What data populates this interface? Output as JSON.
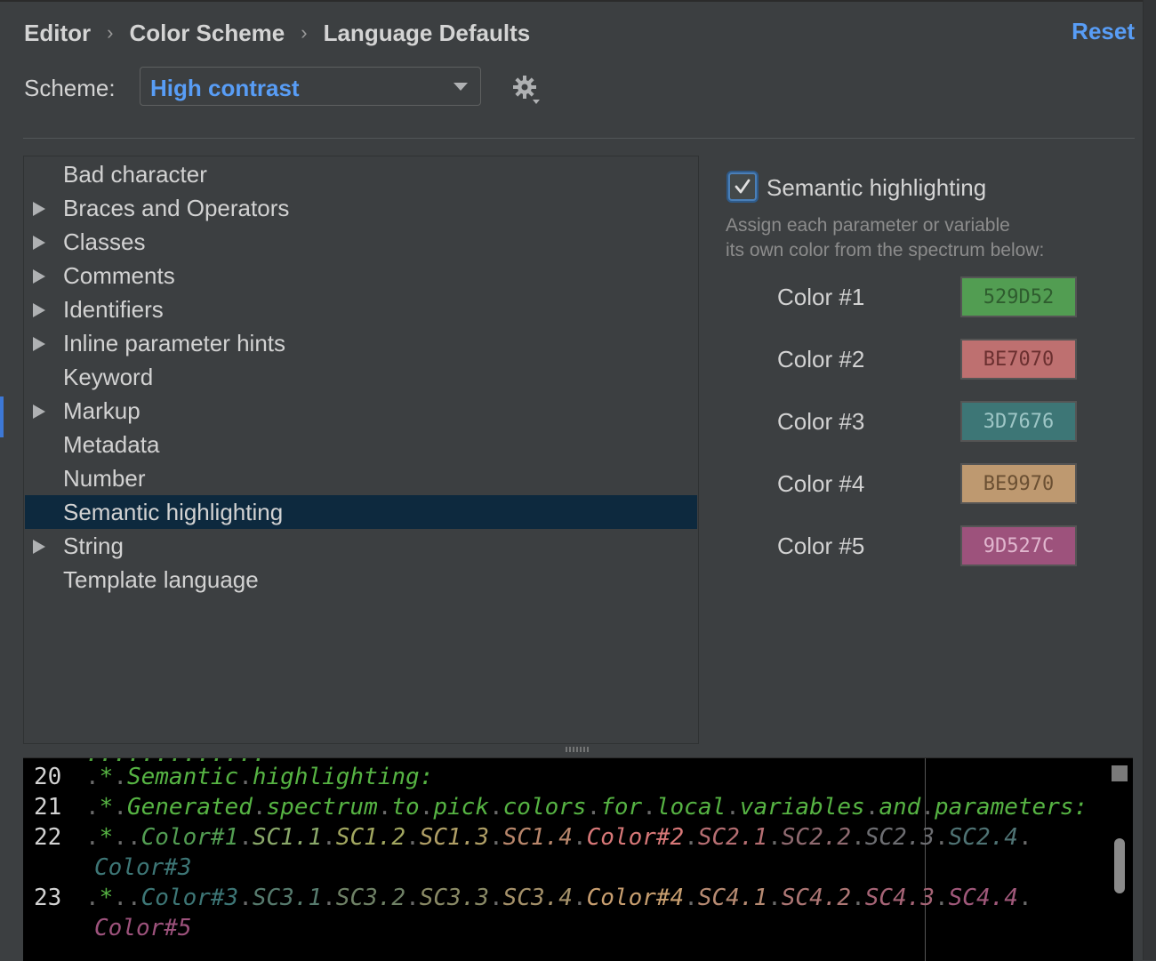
{
  "breadcrumb": [
    "Editor",
    "Color Scheme",
    "Language Defaults"
  ],
  "breadcrumb_sep": "›",
  "reset_label": "Reset",
  "scheme": {
    "label": "Scheme:",
    "value": "High contrast"
  },
  "tree_items": [
    {
      "label": "Bad character",
      "expandable": false
    },
    {
      "label": "Braces and Operators",
      "expandable": true
    },
    {
      "label": "Classes",
      "expandable": true
    },
    {
      "label": "Comments",
      "expandable": true
    },
    {
      "label": "Identifiers",
      "expandable": true
    },
    {
      "label": "Inline parameter hints",
      "expandable": true
    },
    {
      "label": "Keyword",
      "expandable": false
    },
    {
      "label": "Markup",
      "expandable": true
    },
    {
      "label": "Metadata",
      "expandable": false
    },
    {
      "label": "Number",
      "expandable": false
    },
    {
      "label": "Semantic highlighting",
      "expandable": false,
      "selected": true
    },
    {
      "label": "String",
      "expandable": true
    },
    {
      "label": "Template language",
      "expandable": false
    }
  ],
  "semantic": {
    "checkbox_label": "Semantic highlighting",
    "checked": true,
    "desc_line1": "Assign each parameter or variable",
    "desc_line2": "its own color from the spectrum below:",
    "colors": [
      {
        "label": "Color #1",
        "hex": "529D52",
        "bg": "#529D52",
        "fg": "#2f5d2f"
      },
      {
        "label": "Color #2",
        "hex": "BE7070",
        "bg": "#BE7070",
        "fg": "#6b3030"
      },
      {
        "label": "Color #3",
        "hex": "3D7676",
        "bg": "#3D7676",
        "fg": "#9ec6c6"
      },
      {
        "label": "Color #4",
        "hex": "BE9970",
        "bg": "#BE9970",
        "fg": "#6b5033"
      },
      {
        "label": "Color #5",
        "hex": "9D527C",
        "bg": "#9D527C",
        "fg": "#e0b6ce"
      }
    ]
  },
  "editor": {
    "line20": {
      "num": "20",
      "text": "Semantic highlighting:"
    },
    "line21": {
      "num": "21",
      "text": "Generated spectrum to pick colors for local variables and parameters:"
    },
    "line22": {
      "num": "22",
      "tokens": [
        {
          "t": "Color#1",
          "c": "#529D52"
        },
        {
          "t": "SC1.1",
          "c": "#8aa86a"
        },
        {
          "t": "SC1.2",
          "c": "#a2a760"
        },
        {
          "t": "SC1.3",
          "c": "#b09f66"
        },
        {
          "t": "SC1.4",
          "c": "#b8866b"
        },
        {
          "t": "Color#2",
          "c": "#d87878"
        },
        {
          "t": "SC2.1",
          "c": "#b56e72"
        },
        {
          "t": "SC2.2",
          "c": "#8f6a70"
        },
        {
          "t": "SC2.3",
          "c": "#6d6e72"
        },
        {
          "t": "SC2.4",
          "c": "#4f7374"
        }
      ],
      "wrap": {
        "t": "Color#3",
        "c": "#3D7676"
      }
    },
    "line23": {
      "num": "23",
      "tokens": [
        {
          "t": "Color#3",
          "c": "#3D7676"
        },
        {
          "t": "SC3.1",
          "c": "#577b6e"
        },
        {
          "t": "SC3.2",
          "c": "#6f8166"
        },
        {
          "t": "SC3.3",
          "c": "#8a8a66"
        },
        {
          "t": "SC3.4",
          "c": "#a5916a"
        },
        {
          "t": "Color#4",
          "c": "#c99f70"
        },
        {
          "t": "SC4.1",
          "c": "#b68a72"
        },
        {
          "t": "SC4.2",
          "c": "#ad7674"
        },
        {
          "t": "SC4.3",
          "c": "#a66476"
        },
        {
          "t": "SC4.4",
          "c": "#a0587a"
        }
      ],
      "wrap": {
        "t": "Color#5",
        "c": "#9D527C"
      }
    }
  }
}
